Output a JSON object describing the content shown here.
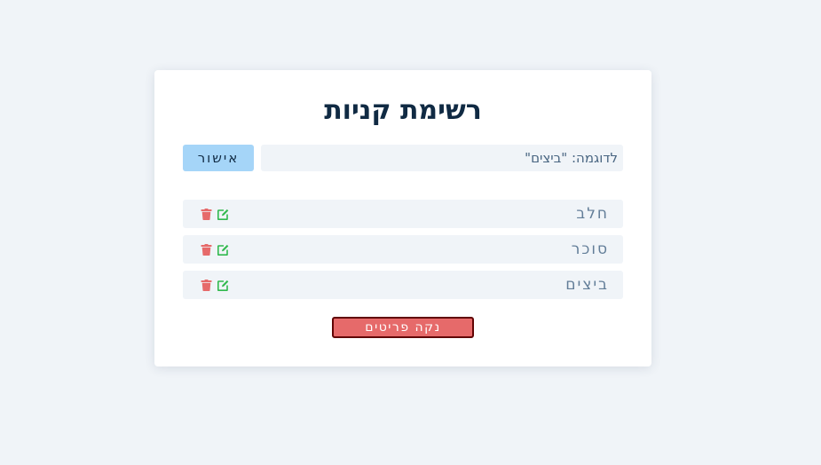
{
  "app": {
    "title": "רשימת קניות"
  },
  "form": {
    "input_value": "",
    "input_placeholder": "לדוגמה: \"ביצים\"",
    "submit_label": "אישור"
  },
  "items": [
    {
      "name": "חלב"
    },
    {
      "name": "סוכר"
    },
    {
      "name": "ביצים"
    }
  ],
  "actions": {
    "clear_label": "נקה פריטים"
  },
  "icons": {
    "delete": "trash-icon",
    "edit": "edit-icon"
  },
  "colors": {
    "background": "#f0f4f8",
    "card": "#ffffff",
    "title": "#102a43",
    "submit_button": "#a5d5f8",
    "clear_button": "#e66a6a",
    "clear_button_border": "#610404",
    "delete_icon": "#e66a6a",
    "edit_icon": "#31b94e"
  }
}
